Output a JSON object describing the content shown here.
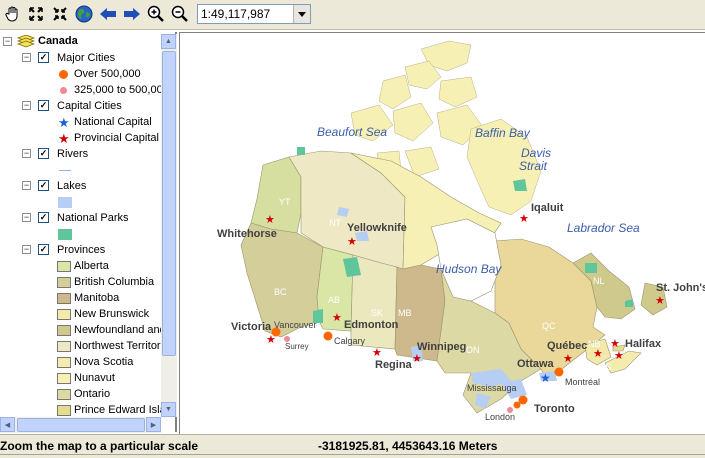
{
  "toolbar": {
    "tools": [
      "pan-icon",
      "zoom-full-extent-icon",
      "zoom-previous-extent-icon",
      "globe-icon",
      "back-arrow-icon",
      "forward-arrow-icon",
      "zoom-in-icon",
      "zoom-out-icon"
    ],
    "scale_value": "1:49,117,987"
  },
  "toc": {
    "root_label": "Canada",
    "layers": {
      "major_cities": {
        "label": "Major Cities",
        "classes": [
          "Over 500,000",
          "325,000 to 500,000"
        ]
      },
      "capital_cities": {
        "label": "Capital Cities",
        "classes": [
          "National Capital",
          "Provincial Capital"
        ]
      },
      "rivers": {
        "label": "Rivers"
      },
      "lakes": {
        "label": "Lakes"
      },
      "national_parks": {
        "label": "National Parks"
      },
      "provinces": {
        "label": "Provinces",
        "classes": [
          "Alberta",
          "British Columbia",
          "Manitoba",
          "New Brunswick",
          "Newfoundland and",
          "Northwest Territor",
          "Nova Scotia",
          "Nunavut",
          "Ontario",
          "Prince Edward Isla"
        ]
      }
    }
  },
  "map": {
    "water_labels": [
      "Beaufort Sea",
      "Baffin Bay",
      "Davis",
      "Strait",
      "Labrador Sea",
      "Hudson Bay"
    ],
    "province_abbrevs": [
      "YT",
      "NT",
      "BC",
      "AB",
      "SK",
      "MB",
      "ON",
      "QC",
      "NL",
      "NB",
      "NS"
    ],
    "city_labels": [
      "Whitehorse",
      "Yellowknife",
      "Iqaluit",
      "Victoria",
      "Vancouver",
      "Surrey",
      "Calgary",
      "Edmonton",
      "Regina",
      "Winnipeg",
      "Ottawa",
      "Québec",
      "Montréal",
      "Halifax",
      "St. John's",
      "Mississauga",
      "Toronto",
      "London"
    ]
  },
  "status": {
    "message": "Zoom the map to a particular scale",
    "coordinates": "-3181925.81, 4453643.16 Meters"
  },
  "colors": {
    "alberta": "#d9e6a6",
    "british_columbia": "#d4ce9a",
    "manitoba": "#cdb98b",
    "new_brunswick": "#f2eaa8",
    "newfoundland": "#d0c98c",
    "northwest_territories": "#eee8c4",
    "nova_scotia": "#f3ecae",
    "nunavut": "#f6f0b5",
    "ontario": "#ddd9a4",
    "quebec": "#e9d899",
    "saskatchewan": "#ece8bd",
    "yukon": "#d6dea0",
    "lakes": "#b6cdf4",
    "national_parks": "#5fc59b",
    "major_city_large": "#ff6600",
    "major_city_medium": "#f28a96",
    "capital_star": "#d40000",
    "national_capital_star": "#1c5fd6"
  }
}
